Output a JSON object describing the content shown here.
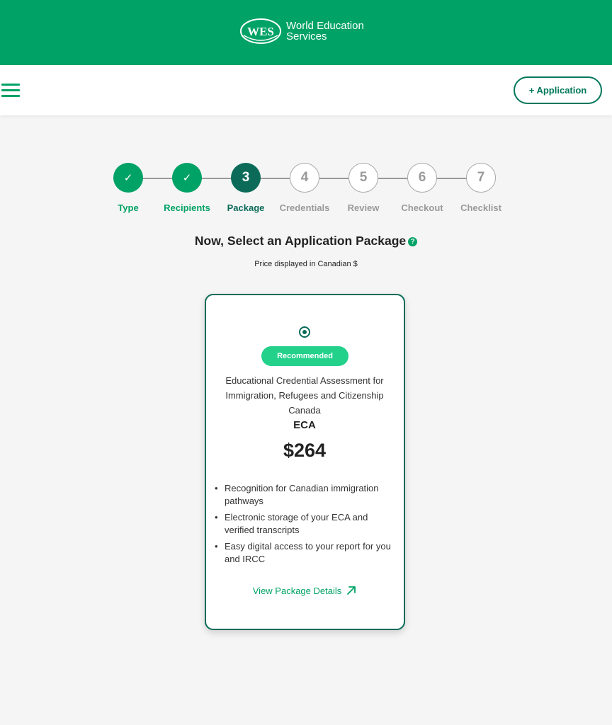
{
  "header": {
    "logo_mark": "WES",
    "brand_line1": "World Education",
    "brand_line2": "Services"
  },
  "nav": {
    "menu_icon": "hamburger-menu-icon",
    "add_application_label": "+ Application"
  },
  "stepper": {
    "steps": [
      {
        "number": "1",
        "label": "Type",
        "state": "done",
        "icon": "check-icon"
      },
      {
        "number": "2",
        "label": "Recipients",
        "state": "done",
        "icon": "check-icon"
      },
      {
        "number": "3",
        "label": "Package",
        "state": "current"
      },
      {
        "number": "4",
        "label": "Credentials",
        "state": "todo"
      },
      {
        "number": "5",
        "label": "Review",
        "state": "todo"
      },
      {
        "number": "6",
        "label": "Checkout",
        "state": "todo"
      },
      {
        "number": "7",
        "label": "Checklist",
        "state": "todo"
      }
    ]
  },
  "page": {
    "title": "Now, Select an Application Package",
    "help_icon": "?",
    "subtitle": "Price displayed in Canadian $"
  },
  "package": {
    "selected": true,
    "badge": "Recommended",
    "description": "Educational Credential Assessment for Immigration, Refugees and Citizenship Canada",
    "name": "ECA",
    "price": "$264",
    "features": [
      "Recognition for Canadian immigration pathways",
      "Electronic storage of your ECA and verified transcripts",
      "Easy digital access to your report for you and IRCC"
    ],
    "details_link": "View Package Details",
    "details_icon": "external-arrow-icon"
  },
  "colors": {
    "brand_green": "#00a266",
    "dark_green": "#0b6b58",
    "badge_green": "#23d18b",
    "inactive_gray": "#9a9a9a"
  }
}
